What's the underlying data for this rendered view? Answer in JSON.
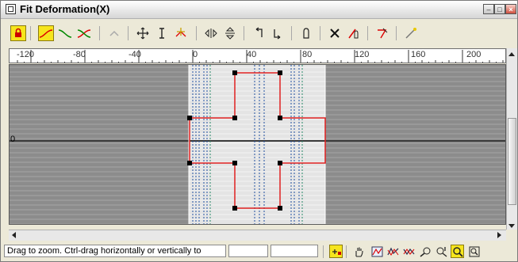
{
  "window": {
    "title": "Fit Deformation(X)",
    "controls": [
      "minimize",
      "maximize",
      "close"
    ]
  },
  "toolbar": {
    "buttons": [
      {
        "name": "make-symmetrical-button",
        "icon": "lock-key-icon",
        "active": true
      },
      {
        "name": "display-x-axis-button",
        "icon": "red-curve-icon",
        "active": true
      },
      {
        "name": "display-y-axis-button",
        "icon": "green-curve-icon",
        "active": false
      },
      {
        "name": "display-xy-axes-button",
        "icon": "red-green-curves-icon",
        "active": false
      },
      {
        "name": "swap-curves-button",
        "icon": "swap-curves-icon",
        "active": false
      },
      {
        "name": "move-control-point-button",
        "icon": "move-icon",
        "active": false
      },
      {
        "name": "scale-control-point-button",
        "icon": "scale-icon",
        "active": false
      },
      {
        "name": "insert-corner-point-button",
        "icon": "insert-point-icon",
        "active": false
      },
      {
        "name": "mirror-horizontally-button",
        "icon": "mirror-horizontal-icon",
        "active": false
      },
      {
        "name": "mirror-vertically-button",
        "icon": "mirror-vertical-icon",
        "active": false
      },
      {
        "name": "rotate-90-ccw-button",
        "icon": "rotate-ccw-icon",
        "active": false
      },
      {
        "name": "rotate-90-cw-button",
        "icon": "rotate-cw-icon",
        "active": false
      },
      {
        "name": "delete-control-point-button",
        "icon": "delete-point-icon",
        "active": false
      },
      {
        "name": "reset-curve-button",
        "icon": "reset-icon",
        "active": false
      },
      {
        "name": "delete-curve-button",
        "icon": "delete-curve-icon",
        "active": false
      },
      {
        "name": "get-shape-button",
        "icon": "get-shape-icon",
        "active": false
      },
      {
        "name": "generate-path-button",
        "icon": "generate-path-icon",
        "active": false
      }
    ]
  },
  "ruler": {
    "labels": [
      "-120",
      "-80",
      "-40",
      "0",
      "40",
      "80",
      "120",
      "160",
      "200"
    ]
  },
  "graph": {
    "y_label": "0",
    "curve_color": "#e02020",
    "background_color": "#8c8c8c",
    "axis_color": "#3a3a3a"
  },
  "statusbar": {
    "prompt": "Drag to zoom. Ctrl-drag horizontally or vertically to",
    "buttons": [
      {
        "name": "lock-aspect-button",
        "icon": "lock-aspect-icon",
        "active": true
      },
      {
        "name": "pan-button",
        "icon": "hand-icon",
        "active": false
      },
      {
        "name": "zoom-extents-button",
        "icon": "zoom-extents-icon",
        "active": false
      },
      {
        "name": "zoom-horizontal-extents-button",
        "icon": "zoom-horizontal-extents-icon",
        "active": false
      },
      {
        "name": "zoom-vertical-extents-button",
        "icon": "zoom-vertical-extents-icon",
        "active": false
      },
      {
        "name": "zoom-horizontally-button",
        "icon": "zoom-horizontal-icon",
        "active": false
      },
      {
        "name": "zoom-vertically-button",
        "icon": "zoom-vertical-icon",
        "active": false
      },
      {
        "name": "zoom-button",
        "icon": "magnifier-icon",
        "active": true
      },
      {
        "name": "zoom-region-button",
        "icon": "zoom-region-icon",
        "active": false
      }
    ]
  }
}
